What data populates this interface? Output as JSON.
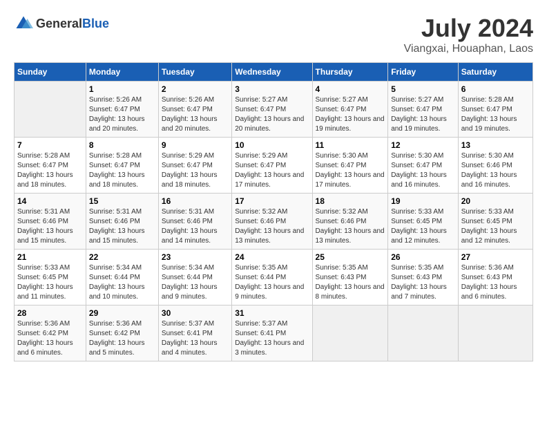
{
  "logo": {
    "general": "General",
    "blue": "Blue"
  },
  "title": "July 2024",
  "subtitle": "Viangxai, Houaphan, Laos",
  "days_header": [
    "Sunday",
    "Monday",
    "Tuesday",
    "Wednesday",
    "Thursday",
    "Friday",
    "Saturday"
  ],
  "weeks": [
    [
      {
        "day": "",
        "info": ""
      },
      {
        "day": "1",
        "info": "Sunrise: 5:26 AM\nSunset: 6:47 PM\nDaylight: 13 hours and 20 minutes."
      },
      {
        "day": "2",
        "info": "Sunrise: 5:26 AM\nSunset: 6:47 PM\nDaylight: 13 hours and 20 minutes."
      },
      {
        "day": "3",
        "info": "Sunrise: 5:27 AM\nSunset: 6:47 PM\nDaylight: 13 hours and 20 minutes."
      },
      {
        "day": "4",
        "info": "Sunrise: 5:27 AM\nSunset: 6:47 PM\nDaylight: 13 hours and 19 minutes."
      },
      {
        "day": "5",
        "info": "Sunrise: 5:27 AM\nSunset: 6:47 PM\nDaylight: 13 hours and 19 minutes."
      },
      {
        "day": "6",
        "info": "Sunrise: 5:28 AM\nSunset: 6:47 PM\nDaylight: 13 hours and 19 minutes."
      }
    ],
    [
      {
        "day": "7",
        "info": "Sunrise: 5:28 AM\nSunset: 6:47 PM\nDaylight: 13 hours and 18 minutes."
      },
      {
        "day": "8",
        "info": "Sunrise: 5:28 AM\nSunset: 6:47 PM\nDaylight: 13 hours and 18 minutes."
      },
      {
        "day": "9",
        "info": "Sunrise: 5:29 AM\nSunset: 6:47 PM\nDaylight: 13 hours and 18 minutes."
      },
      {
        "day": "10",
        "info": "Sunrise: 5:29 AM\nSunset: 6:47 PM\nDaylight: 13 hours and 17 minutes."
      },
      {
        "day": "11",
        "info": "Sunrise: 5:30 AM\nSunset: 6:47 PM\nDaylight: 13 hours and 17 minutes."
      },
      {
        "day": "12",
        "info": "Sunrise: 5:30 AM\nSunset: 6:47 PM\nDaylight: 13 hours and 16 minutes."
      },
      {
        "day": "13",
        "info": "Sunrise: 5:30 AM\nSunset: 6:46 PM\nDaylight: 13 hours and 16 minutes."
      }
    ],
    [
      {
        "day": "14",
        "info": "Sunrise: 5:31 AM\nSunset: 6:46 PM\nDaylight: 13 hours and 15 minutes."
      },
      {
        "day": "15",
        "info": "Sunrise: 5:31 AM\nSunset: 6:46 PM\nDaylight: 13 hours and 15 minutes."
      },
      {
        "day": "16",
        "info": "Sunrise: 5:31 AM\nSunset: 6:46 PM\nDaylight: 13 hours and 14 minutes."
      },
      {
        "day": "17",
        "info": "Sunrise: 5:32 AM\nSunset: 6:46 PM\nDaylight: 13 hours and 13 minutes."
      },
      {
        "day": "18",
        "info": "Sunrise: 5:32 AM\nSunset: 6:46 PM\nDaylight: 13 hours and 13 minutes."
      },
      {
        "day": "19",
        "info": "Sunrise: 5:33 AM\nSunset: 6:45 PM\nDaylight: 13 hours and 12 minutes."
      },
      {
        "day": "20",
        "info": "Sunrise: 5:33 AM\nSunset: 6:45 PM\nDaylight: 13 hours and 12 minutes."
      }
    ],
    [
      {
        "day": "21",
        "info": "Sunrise: 5:33 AM\nSunset: 6:45 PM\nDaylight: 13 hours and 11 minutes."
      },
      {
        "day": "22",
        "info": "Sunrise: 5:34 AM\nSunset: 6:44 PM\nDaylight: 13 hours and 10 minutes."
      },
      {
        "day": "23",
        "info": "Sunrise: 5:34 AM\nSunset: 6:44 PM\nDaylight: 13 hours and 9 minutes."
      },
      {
        "day": "24",
        "info": "Sunrise: 5:35 AM\nSunset: 6:44 PM\nDaylight: 13 hours and 9 minutes."
      },
      {
        "day": "25",
        "info": "Sunrise: 5:35 AM\nSunset: 6:43 PM\nDaylight: 13 hours and 8 minutes."
      },
      {
        "day": "26",
        "info": "Sunrise: 5:35 AM\nSunset: 6:43 PM\nDaylight: 13 hours and 7 minutes."
      },
      {
        "day": "27",
        "info": "Sunrise: 5:36 AM\nSunset: 6:43 PM\nDaylight: 13 hours and 6 minutes."
      }
    ],
    [
      {
        "day": "28",
        "info": "Sunrise: 5:36 AM\nSunset: 6:42 PM\nDaylight: 13 hours and 6 minutes."
      },
      {
        "day": "29",
        "info": "Sunrise: 5:36 AM\nSunset: 6:42 PM\nDaylight: 13 hours and 5 minutes."
      },
      {
        "day": "30",
        "info": "Sunrise: 5:37 AM\nSunset: 6:41 PM\nDaylight: 13 hours and 4 minutes."
      },
      {
        "day": "31",
        "info": "Sunrise: 5:37 AM\nSunset: 6:41 PM\nDaylight: 13 hours and 3 minutes."
      },
      {
        "day": "",
        "info": ""
      },
      {
        "day": "",
        "info": ""
      },
      {
        "day": "",
        "info": ""
      }
    ]
  ]
}
